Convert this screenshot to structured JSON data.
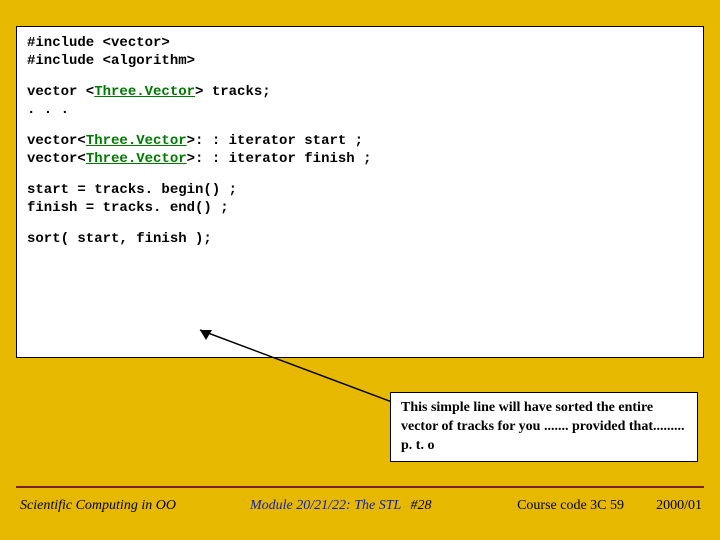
{
  "code": {
    "inc1": "#include <vector>",
    "inc2": "#include <algorithm>",
    "decl_pre": "vector <",
    "decl_type": "Three.Vector",
    "decl_post": "> tracks;",
    "dots": ". . .",
    "it1_pre": "vector<",
    "it1_type": "Three.Vector",
    "it1_post": ">: : iterator start ;",
    "it2_pre": "vector<",
    "it2_type": "Three.Vector",
    "it2_post": ">: : iterator finish ;",
    "assign1": "start  = tracks. begin() ;",
    "assign2": "finish = tracks. end() ;",
    "sort": "sort( start, finish );"
  },
  "annotation": {
    "text": "This simple line will have sorted the entire vector of tracks for you ....... provided that......... p. t. o"
  },
  "footer": {
    "left": "Scientific Computing in OO",
    "module": "Module 20/21/22: The STL",
    "tag": "#28",
    "course": "Course code 3C 59",
    "year": "2000/01"
  }
}
